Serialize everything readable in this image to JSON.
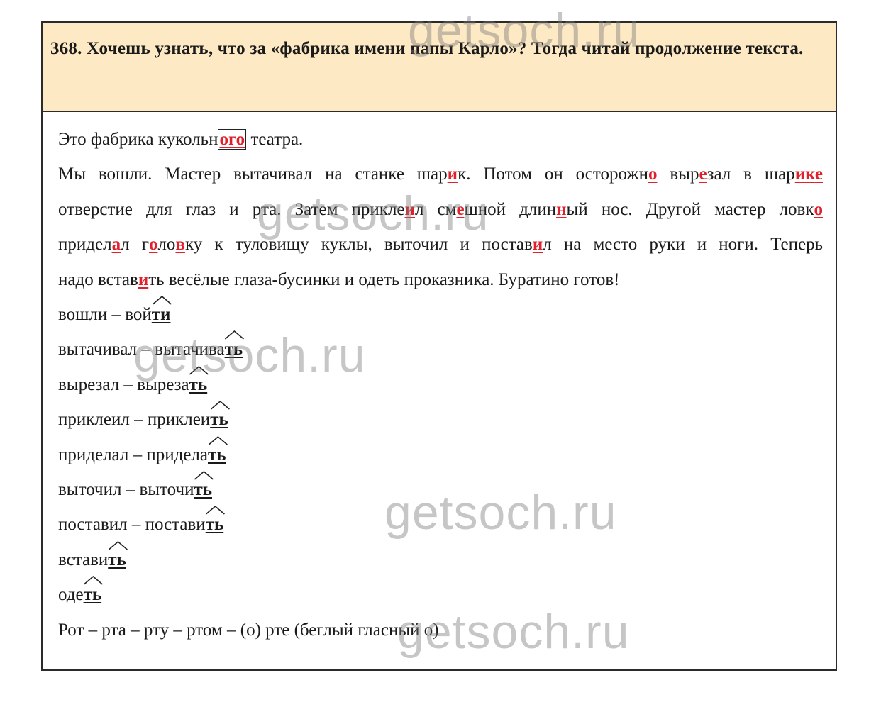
{
  "task": {
    "number": "368.",
    "text": "Хочешь узнать, что за «фабрика имени папы Карло»? Тогда читай продолжение текста."
  },
  "paragraph": {
    "l1": [
      "Это фабрика кукольн",
      "ого",
      " театра."
    ],
    "l2": [
      "Мы вошли. Мастер вытачивал на станке шар",
      "и",
      "к. Потом он осторожн",
      "о",
      " выр",
      "е",
      "зал в шар",
      "ик",
      "е"
    ],
    "l3": [
      "отверстие для глаз и рта. Затем прикле",
      "и",
      "л см",
      "е",
      "шной длин",
      "н",
      "ый нос. Другой мастер ловк",
      "о"
    ],
    "l4": [
      "придел",
      "а",
      "л г",
      "о",
      "ло",
      "в",
      "ку к туловищу куклы, выточил и постав",
      "и",
      "л на место руки и ноги. Теперь"
    ],
    "l5": [
      "надо встав",
      "и",
      "ть весёлые глаза-бусинки и одеть проказника. Буратино готов!"
    ]
  },
  "word_pairs": [
    {
      "past": "вошли – вой",
      "suffix": "ти"
    },
    {
      "past": "вытачивал – вытачива",
      "suffix": "ть"
    },
    {
      "past": "вырезал – выреза",
      "suffix": "ть"
    },
    {
      "past": "приклеил – приклеи",
      "suffix": "ть"
    },
    {
      "past": "приделал – приделa",
      "suffix": "ть"
    },
    {
      "past": "выточил – выточи",
      "suffix": "ть"
    },
    {
      "past": "поставил – постави",
      "suffix": "ть"
    },
    {
      "past": "встави",
      "suffix": "ть"
    },
    {
      "past": "оде",
      "suffix": "ть"
    }
  ],
  "note": "Рот – рта – рту – ртом – (о) рте (беглый гласный о)",
  "watermark": "getsoch.ru",
  "colors": {
    "header_bg": "#fde9c3",
    "highlight": "#e0202b"
  }
}
